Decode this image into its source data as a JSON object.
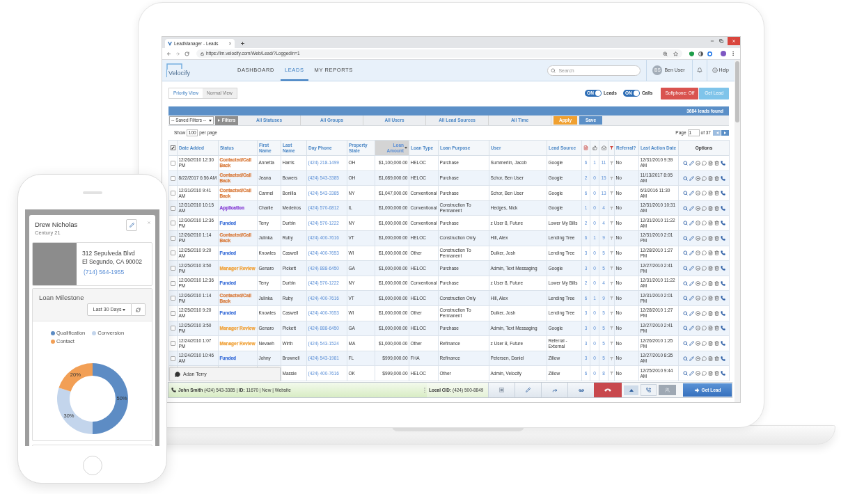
{
  "browser": {
    "tab_title": "LeadManager - Leads",
    "url": "https://lm.velocify.com/Web/Lead/?LoggedIn=1"
  },
  "app_header": {
    "logo": "Velocify",
    "nav": [
      {
        "label": "DASHBOARD",
        "selected": false
      },
      {
        "label": "LEADS",
        "selected": true
      },
      {
        "label": "MY REPORTS",
        "selected": false
      }
    ],
    "search": {
      "placeholder": "Search"
    },
    "user": {
      "initials": "BS",
      "name": "Ben User"
    },
    "help": "Help"
  },
  "toolbar": {
    "views": [
      {
        "label": "Priority View",
        "selected": true
      },
      {
        "label": "Normal View",
        "selected": false
      }
    ],
    "toggles": [
      {
        "state_text": "ON",
        "label": "Leads",
        "on": true
      },
      {
        "state_text": "ON",
        "label": "Calls",
        "on": true
      }
    ],
    "softphone_button": "Softphone: Off",
    "get_lead_button": "Get Lead"
  },
  "results_bar": {
    "count": "3684 leads found"
  },
  "filters": {
    "saved_filters": "-- Saved Filters --",
    "filters_button": "Filters",
    "dropdowns": [
      "All Statuses",
      "All Groups",
      "All Users",
      "All Lead Sources",
      "All Time"
    ],
    "apply_button": "Apply",
    "save_button": "Save"
  },
  "paging": {
    "show_label": "Show",
    "page_size": "100",
    "per_page_label": "per page",
    "page_label": "Page",
    "page": "1",
    "page_count": "of 37"
  },
  "table": {
    "columns": [
      {
        "kind": "select"
      },
      {
        "kind": "text",
        "label": "Date Added",
        "sorted": false
      },
      {
        "kind": "text",
        "label": "Status",
        "sorted": false
      },
      {
        "kind": "text",
        "label": "First Name",
        "sorted": false
      },
      {
        "kind": "text",
        "label": "Last Name",
        "sorted": false
      },
      {
        "kind": "text",
        "label": "Day Phone",
        "sorted": false
      },
      {
        "kind": "text",
        "label": "Property State",
        "sorted": false
      },
      {
        "kind": "text",
        "label": "Loan Amount",
        "sorted": true
      },
      {
        "kind": "text",
        "label": "Loan Type",
        "sorted": false
      },
      {
        "kind": "text",
        "label": "Loan Purpose",
        "sorted": false
      },
      {
        "kind": "text",
        "label": "User",
        "sorted": false
      },
      {
        "kind": "text",
        "label": "Lead Source",
        "sorted": false
      },
      {
        "kind": "icon"
      },
      {
        "kind": "icon"
      },
      {
        "kind": "icon"
      },
      {
        "kind": "icon"
      },
      {
        "kind": "text",
        "label": "Referral?",
        "sorted": false
      },
      {
        "kind": "text",
        "label": "Last Action Date",
        "sorted": false
      },
      {
        "kind": "actions",
        "label": "Options"
      }
    ],
    "rows": [
      {
        "checked": false,
        "date_added": "12/26/2010 12:30 PM",
        "status": {
          "text": "Contacted/Call Back",
          "color": "#d97b3c"
        },
        "first_name": "Annetta",
        "last_name": "Harris",
        "day_phone": "(424) 218-1499",
        "property_state": "OH",
        "loan_amount": "$1,100,000.00",
        "loan_type": "HELOC",
        "loan_purpose": "Purchase",
        "user": "Summerlin, Jacob",
        "lead_source": "Google",
        "count_1": "6",
        "count_2": "1",
        "count_3": "11",
        "referral": "No",
        "last_action_date": "12/31/2010 9:39 AM"
      },
      {
        "checked": false,
        "date_added": "8/22/2017 6:56 AM",
        "status": {
          "text": "Contacted/Call Back",
          "color": "#d97b3c"
        },
        "first_name": "Jeana",
        "last_name": "Bowers",
        "day_phone": "(424) 543-3385",
        "property_state": "OH",
        "loan_amount": "$1,089,000.00",
        "loan_type": "HELOC",
        "loan_purpose": "Purchase",
        "user": "Schor, Ben User",
        "lead_source": "Google",
        "count_1": "2",
        "count_2": "0",
        "count_3": "15",
        "referral": "No",
        "last_action_date": "11/13/2017 8:05 AM"
      },
      {
        "checked": false,
        "date_added": "12/31/2010 9:41 AM",
        "status": {
          "text": "Contacted/Call Back",
          "color": "#d97b3c"
        },
        "first_name": "Carmel",
        "last_name": "Bonilla",
        "day_phone": "(424) 543-3385",
        "property_state": "NY",
        "loan_amount": "$1,047,000.00",
        "loan_type": "Conventional",
        "loan_purpose": "Purchase",
        "user": "Schor, Ben User",
        "lead_source": "Google",
        "count_1": "6",
        "count_2": "0",
        "count_3": "13",
        "referral": "No",
        "last_action_date": "6/3/2016 11:30 AM"
      },
      {
        "checked": false,
        "date_added": "12/31/2010 10:15 AM",
        "status": {
          "text": "Application",
          "color": "#8a46d6"
        },
        "first_name": "Charlie",
        "last_name": "Medeiros",
        "day_phone": "(424) 570-6812",
        "property_state": "IL",
        "loan_amount": "$1,000,000.00",
        "loan_type": "Conventional",
        "loan_purpose": "Construction To Permanent",
        "user": "Hedges, Nick",
        "lead_source": "Google",
        "count_1": "1",
        "count_2": "0",
        "count_3": "4",
        "referral": "No",
        "last_action_date": "12/31/2010 10:31 AM"
      },
      {
        "checked": false,
        "date_added": "12/30/2010 12:36 PM",
        "status": {
          "text": "Funded",
          "color": "#3b6fd8"
        },
        "first_name": "Terry",
        "last_name": "Durbin",
        "day_phone": "(424) 570-1222",
        "property_state": "NY",
        "loan_amount": "$1,000,000.00",
        "loan_type": "Conventional",
        "loan_purpose": "Purchase",
        "user": "z User 8, Future",
        "lead_source": "Lower My Bills",
        "count_1": "2",
        "count_2": "0",
        "count_3": "4",
        "referral": "No",
        "last_action_date": "12/31/2010 11:22 AM"
      },
      {
        "checked": false,
        "date_added": "12/26/2010 1:14 PM",
        "status": {
          "text": "Contacted/Call Back",
          "color": "#d97b3c"
        },
        "first_name": "Julinka",
        "last_name": "Ruby",
        "day_phone": "(424) 400-7616",
        "property_state": "VT",
        "loan_amount": "$1,000,000.00",
        "loan_type": "HELOC",
        "loan_purpose": "Construction Only",
        "user": "Hill, Alex",
        "lead_source": "Lending Tree",
        "count_1": "6",
        "count_2": "1",
        "count_3": "9",
        "referral": "No",
        "last_action_date": "12/31/2010 2:01 PM"
      },
      {
        "checked": false,
        "date_added": "12/25/2010 9:20 AM",
        "status": {
          "text": "Funded",
          "color": "#3b6fd8"
        },
        "first_name": "Knowles",
        "last_name": "Caswell",
        "day_phone": "(424) 400-7653",
        "property_state": "WI",
        "loan_amount": "$1,000,000.00",
        "loan_type": "Other",
        "loan_purpose": "Construction To Permanent",
        "user": "Duiker, Josh",
        "lead_source": "Lending Tree",
        "count_1": "3",
        "count_2": "0",
        "count_3": "5",
        "referral": "No",
        "last_action_date": "12/28/2010 1:27 PM"
      },
      {
        "checked": false,
        "date_added": "12/25/2010 3:50 PM",
        "status": {
          "text": "Manager Review",
          "color": "#f0a23a"
        },
        "first_name": "Genaro",
        "last_name": "Pickett",
        "day_phone": "(424) 888-6450",
        "property_state": "GA",
        "loan_amount": "$1,000,000.00",
        "loan_type": "HELOC",
        "loan_purpose": "Purchase",
        "user": "Admin, Text Messaging",
        "lead_source": "Google",
        "count_1": "3",
        "count_2": "0",
        "count_3": "5",
        "referral": "No",
        "last_action_date": "12/27/2010 2:41 PM"
      },
      {
        "checked": false,
        "date_added": "12/30/2010 12:36 PM",
        "status": {
          "text": "Funded",
          "color": "#3b6fd8"
        },
        "first_name": "Terry",
        "last_name": "Durbin",
        "day_phone": "(424) 570-1222",
        "property_state": "NY",
        "loan_amount": "$1,000,000.00",
        "loan_type": "Conventional",
        "loan_purpose": "Purchase",
        "user": "z User 8, Future",
        "lead_source": "Lower My Bills",
        "count_1": "2",
        "count_2": "0",
        "count_3": "4",
        "referral": "No",
        "last_action_date": "12/31/2010 11:22 AM"
      },
      {
        "checked": false,
        "date_added": "12/26/2010 1:14 PM",
        "status": {
          "text": "Contacted/Call Back",
          "color": "#d97b3c"
        },
        "first_name": "Julinka",
        "last_name": "Ruby",
        "day_phone": "(424) 400-7616",
        "property_state": "VT",
        "loan_amount": "$1,000,000.00",
        "loan_type": "HELOC",
        "loan_purpose": "Construction Only",
        "user": "Hill, Alex",
        "lead_source": "Lending Tree",
        "count_1": "6",
        "count_2": "1",
        "count_3": "9",
        "referral": "No",
        "last_action_date": "12/31/2010 2:01 PM"
      },
      {
        "checked": false,
        "date_added": "12/25/2010 9:20 AM",
        "status": {
          "text": "Funded",
          "color": "#3b6fd8"
        },
        "first_name": "Knowles",
        "last_name": "Caswell",
        "day_phone": "(424) 400-7653",
        "property_state": "WI",
        "loan_amount": "$1,000,000.00",
        "loan_type": "Other",
        "loan_purpose": "Construction To Permanent",
        "user": "Duiker, Josh",
        "lead_source": "Lending Tree",
        "count_1": "3",
        "count_2": "0",
        "count_3": "5",
        "referral": "No",
        "last_action_date": "12/28/2010 1:27 PM"
      },
      {
        "checked": false,
        "date_added": "12/25/2010 3:50 PM",
        "status": {
          "text": "Manager Review",
          "color": "#f0a23a"
        },
        "first_name": "Genaro",
        "last_name": "Pickett",
        "day_phone": "(424) 888-6450",
        "property_state": "GA",
        "loan_amount": "$1,000,000.00",
        "loan_type": "HELOC",
        "loan_purpose": "Purchase",
        "user": "Admin, Text Messaging",
        "lead_source": "Google",
        "count_1": "3",
        "count_2": "0",
        "count_3": "5",
        "referral": "No",
        "last_action_date": "12/27/2010 2:41 PM"
      },
      {
        "checked": false,
        "date_added": "12/24/2010 1:07 PM",
        "status": {
          "text": "Manager Review",
          "color": "#f0a23a"
        },
        "first_name": "Nevaeh",
        "last_name": "Wirth",
        "day_phone": "(424) 543-1524",
        "property_state": "MA",
        "loan_amount": "$1,000,000.00",
        "loan_type": "Other",
        "loan_purpose": "Refinance",
        "user": "z User 8, Future",
        "lead_source": "Referral - External",
        "count_1": "3",
        "count_2": "0",
        "count_3": "5",
        "referral": "No",
        "last_action_date": "12/26/2010 1:25 PM"
      },
      {
        "checked": false,
        "date_added": "12/24/2010 10:46 AM",
        "status": {
          "text": "Funded",
          "color": "#3b6fd8"
        },
        "first_name": "Johny",
        "last_name": "Brownell",
        "day_phone": "(424) 543-1981",
        "property_state": "FL",
        "loan_amount": "$999,000.00",
        "loan_type": "FHA",
        "loan_purpose": "Refinance",
        "user": "Petersen, Daniel",
        "lead_source": "Zillow",
        "count_1": "3",
        "count_2": "0",
        "count_3": "5",
        "referral": "No",
        "last_action_date": "12/27/2010 8:35 AM"
      },
      {
        "last_name": "Massie",
        "day_phone": "(424) 400-7616",
        "property_state": "OK",
        "loan_amount": "$999,000.00",
        "loan_type": "HELOC",
        "loan_purpose": "Other",
        "user": "Admin, Velocify",
        "lead_source": "Zillow",
        "count_1": "6",
        "count_2": "0",
        "count_3": "8",
        "referral": "No",
        "last_action_date": "12/25/2010 9:44 AM"
      }
    ]
  },
  "chat_tab": {
    "name": "Adan Terry"
  },
  "softphone_bar": {
    "caller": "**John Smith** (424) 543-3385 | **ID:** 11670 | New | Website",
    "local_cid": "**Local CID:** (424) 500-8849",
    "get_lead_button": "Get Lead"
  },
  "phone": {
    "contact": {
      "name": "Drew Nicholas",
      "company": "Century 21",
      "address_line_1": "312 Sepulveda Blvd",
      "address_line_2": "El Segundo, CA 90002",
      "phone": "(714) 564-1955"
    },
    "loan_milestone": {
      "title": "Loan Milestone",
      "range": "Last 30 Days",
      "legend": [
        {
          "color": "#5d8cc4"
        },
        {
          "color": "#c3d5ec"
        },
        {
          "color": "#f29f55"
        }
      ],
      "chart_data": {
        "type": "donut",
        "categories": [
          "Qualification",
          "Conversion",
          "Contact"
        ],
        "values": [
          50,
          30,
          20
        ],
        "value_labels": [
          "50%",
          "30%",
          "20%"
        ]
      }
    }
  }
}
